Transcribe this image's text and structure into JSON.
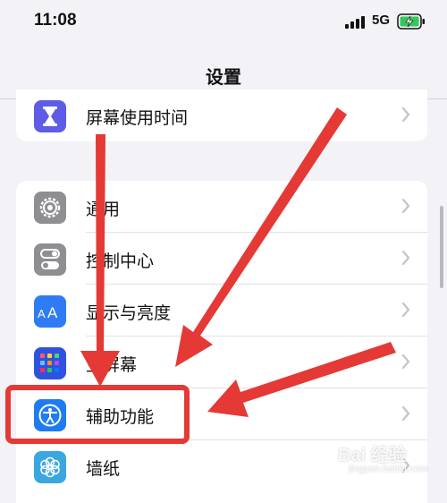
{
  "status_bar": {
    "time": "11:08",
    "network": "5G",
    "signal_icon": "cellular-signal-icon",
    "battery_icon": "battery-charging-icon"
  },
  "nav": {
    "title": "设置"
  },
  "groups": [
    {
      "items": [
        {
          "label": "屏幕使用时间",
          "icon": "hourglass-icon",
          "icon_color": "#5e5ce6"
        }
      ]
    },
    {
      "items": [
        {
          "label": "通用",
          "icon": "gear-icon",
          "icon_color": "#8e8e93"
        },
        {
          "label": "控制中心",
          "icon": "toggle-switches-icon",
          "icon_color": "#8e8e93"
        },
        {
          "label": "显示与亮度",
          "icon": "text-size-icon",
          "icon_color": "#2f7bf5"
        },
        {
          "label": "主屏幕",
          "icon": "home-screen-grid-icon",
          "icon_color": "#2f52e0"
        },
        {
          "label": "辅助功能",
          "icon": "accessibility-icon",
          "icon_color": "#1e7cf2"
        },
        {
          "label": "墙纸",
          "icon": "flower-icon",
          "icon_color": "#3aa7e0"
        }
      ]
    }
  ],
  "annotation": {
    "arrow_color": "#e53935",
    "highlight_target": "辅助功能"
  },
  "watermark": {
    "text": "Bai 经验",
    "sub": "jingyan.baidu.com"
  }
}
